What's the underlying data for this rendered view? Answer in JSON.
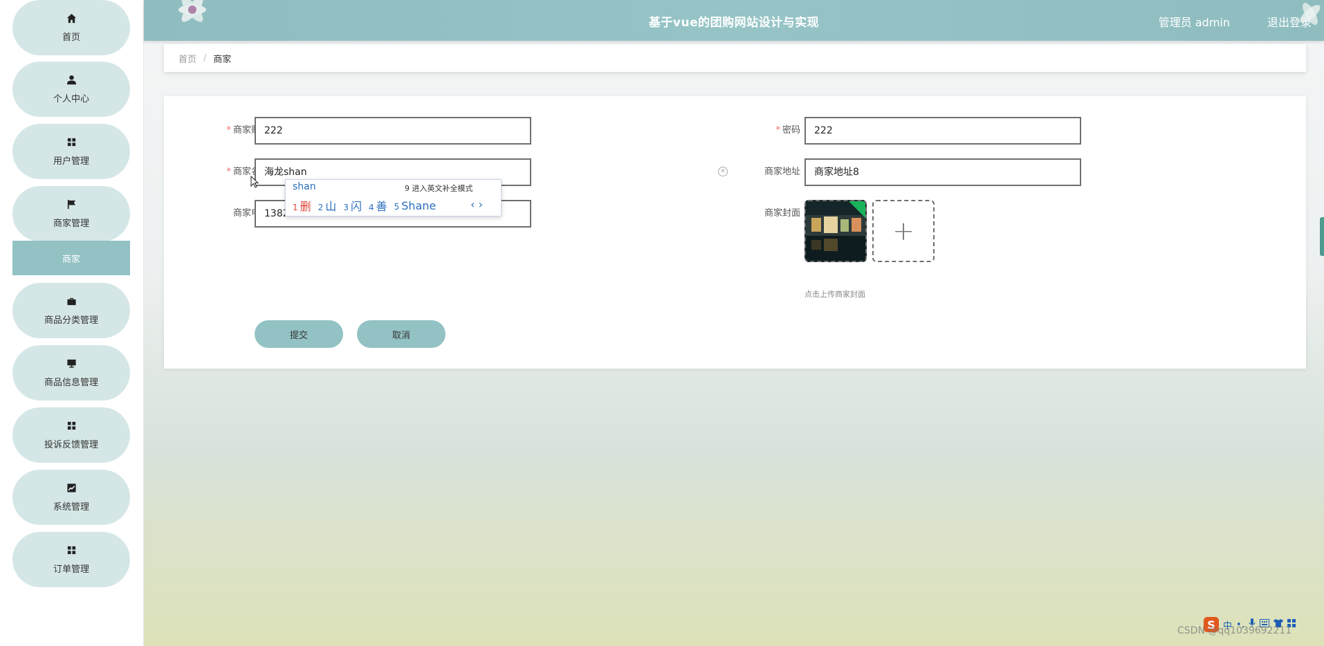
{
  "header": {
    "title": "基于vue的团购网站设计与实现",
    "user_label": "管理员 admin",
    "logout_label": "退出登录"
  },
  "sidebar": {
    "items": [
      {
        "label": "首页",
        "icon": "home-icon"
      },
      {
        "label": "个人中心",
        "icon": "user-icon"
      },
      {
        "label": "用户管理",
        "icon": "grid-icon"
      },
      {
        "label": "商家管理",
        "icon": "flag-icon"
      },
      {
        "label": "商品分类管理",
        "icon": "briefcase-icon"
      },
      {
        "label": "商品信息管理",
        "icon": "monitor-icon"
      },
      {
        "label": "投诉反馈管理",
        "icon": "grid-icon"
      },
      {
        "label": "系统管理",
        "icon": "chart-icon"
      },
      {
        "label": "订单管理",
        "icon": "grid-icon"
      }
    ],
    "active_sub": "商家"
  },
  "breadcrumb": {
    "home": "首页",
    "separator": "/",
    "current": "商家"
  },
  "form": {
    "account": {
      "label": "商家账号",
      "value": "222"
    },
    "password": {
      "label": "密码",
      "value": "222"
    },
    "name": {
      "label": "商家名称",
      "value": "海龙shan"
    },
    "address": {
      "label": "商家地址",
      "value": "商家地址8"
    },
    "phone": {
      "label": "商家电话",
      "value": "1382"
    },
    "cover": {
      "label": "商家封面",
      "tip": "点击上传商家封面"
    },
    "submit_label": "提交",
    "cancel_label": "取消"
  },
  "ime": {
    "typed": "shan",
    "hint": "9 进入英文补全模式",
    "candidates": [
      {
        "num": "1",
        "text": "删"
      },
      {
        "num": "2",
        "text": "山"
      },
      {
        "num": "3",
        "text": "闪"
      },
      {
        "num": "4",
        "text": "善"
      },
      {
        "num": "5",
        "text": "Shane"
      }
    ],
    "pager": "‹ ›"
  },
  "ime_toolbar": {
    "logo": "S",
    "mode": "中"
  },
  "watermark": "CSDN @qq1039692211",
  "colors": {
    "accent": "#93c2c4",
    "sidebar_pill": "#d5e6e6",
    "required": "#f56c6c"
  }
}
